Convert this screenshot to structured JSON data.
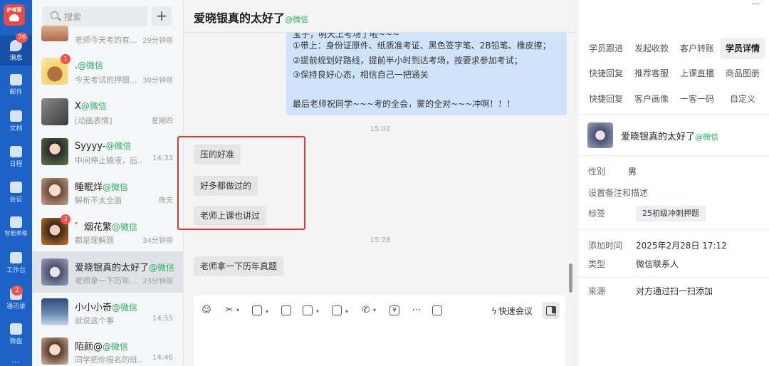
{
  "rail": {
    "logo_text": "护考猫",
    "items": [
      {
        "label": "消息",
        "badge": "76",
        "icon": "chat-bubble-icon"
      },
      {
        "label": "邮件",
        "icon": "mail-icon"
      },
      {
        "label": "文档",
        "icon": "document-icon"
      },
      {
        "label": "日程",
        "icon": "calendar-icon"
      },
      {
        "label": "会议",
        "icon": "meeting-icon"
      },
      {
        "label": "智能表格",
        "icon": "smart-sheet-icon"
      },
      {
        "label": "工作台",
        "icon": "workbench-icon"
      },
      {
        "label": "通讯录",
        "badge": "2",
        "icon": "contacts-icon"
      },
      {
        "label": "微盘",
        "icon": "cloud-drive-icon"
      }
    ],
    "more": "…"
  },
  "search": {
    "placeholder": "搜索",
    "add": "+"
  },
  "conversations": [
    {
      "name": "",
      "suffix": "",
      "preview": "老师今天考的有...",
      "time": "29分钟前"
    },
    {
      "name": ".",
      "suffix": "@微信",
      "preview": "今天考试的押题...",
      "time": "30分钟前",
      "badge": "1"
    },
    {
      "name": "X",
      "suffix": "@微信",
      "preview": "[动画表情]",
      "time": "星期四"
    },
    {
      "name": "Syyyy-",
      "suffix": "@微信",
      "preview": "中间停止输液，后...",
      "time": "14:33"
    },
    {
      "name": "睡眠烊",
      "suffix": "@微信",
      "preview": "解析不太全面",
      "time": "昨天"
    },
    {
      "name": "゛烟花繁",
      "suffix": "@微信",
      "preview": "都是理解题",
      "time": "34分钟前",
      "badge": "3"
    },
    {
      "name": "爱晓银真的太好了",
      "suffix": "@微信",
      "preview": "老师拿一下历年...",
      "time": "23分钟前"
    },
    {
      "name": "小小小奇",
      "suffix": "@微信",
      "preview": "就说这个事",
      "time": "14:55"
    },
    {
      "name": "陌颜@",
      "suffix": "@微信",
      "preview": "同学把你报名的班...",
      "time": "14:46"
    }
  ],
  "chat": {
    "title": "爱晓银真的太好了",
    "title_suffix": "@微信",
    "sys_lines": [
      "宝子，明天上考场了啦~~~",
      "①带上：身份证原件、纸质准考证、黑色签字笔、2B铅笔、橡皮擦；",
      "②提前规划好路线，提前半小时到达考场，按要求参加考试；",
      "③保持良好心态，相信自己一把通关",
      "",
      "最后老师祝同学~~~考的全会，蒙的全对~~~冲啊！！！"
    ],
    "time1": "15:02",
    "messages1": [
      "压的好准",
      "好多都做过的",
      "老师上课也讲过"
    ],
    "time2": "15:28",
    "message2": "老师拿一下历年真题",
    "toolbar": {
      "meeting": "快速会议",
      "bolt": "ϟ",
      "icons": [
        "emoji-icon",
        "scissors-icon",
        "image-icon",
        "file-icon",
        "checklist-icon",
        "folder-icon",
        "phone-icon",
        "payment-icon",
        "more-icon",
        "comment-icon"
      ]
    }
  },
  "right": {
    "tabs_row1": [
      "学员跟进",
      "发起收款",
      "客户转账",
      "学员详情"
    ],
    "tabs_row2": [
      "快捷回复",
      "推荐客服",
      "上课直播",
      "商品图册"
    ],
    "tabs_row3": [
      "快捷回复",
      "客户画像",
      "一客一码",
      "自定义"
    ],
    "profile_name": "爱晓银真的太好了",
    "profile_suffix": "@微信",
    "gender_label": "性别",
    "gender": "男",
    "remark_label": "设置备注和描述",
    "tag_label": "标签",
    "tag": "25初级冲刺押题",
    "added_label": "添加时间",
    "added": "2025年2月28日 17:12",
    "type_label": "类型",
    "type": "微信联系人",
    "source_label": "来源",
    "source": "对方通过扫一扫添加"
  }
}
